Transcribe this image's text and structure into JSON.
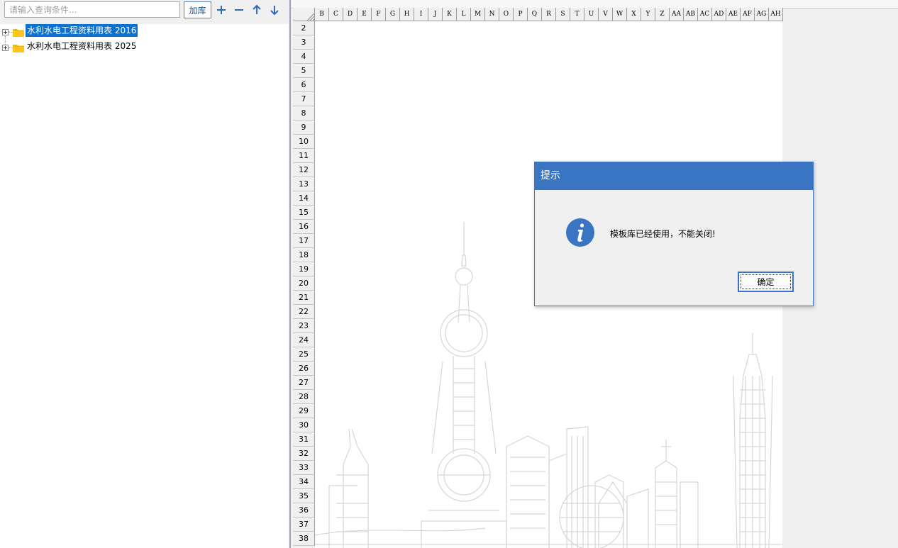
{
  "search": {
    "placeholder": "请输入查询条件..."
  },
  "toolbar": {
    "add_library_label": "加库",
    "icons": [
      "plus-icon",
      "minus-icon",
      "arrow-up-icon",
      "arrow-down-icon"
    ]
  },
  "tree": {
    "items": [
      {
        "label": "水利水电工程资料用表 2016",
        "selected": true
      },
      {
        "label": "水利水电工程资料用表 2025",
        "selected": false
      }
    ]
  },
  "sheet": {
    "columns": [
      "B",
      "C",
      "D",
      "E",
      "F",
      "G",
      "H",
      "I",
      "J",
      "K",
      "L",
      "M",
      "N",
      "O",
      "P",
      "Q",
      "R",
      "S",
      "T",
      "U",
      "V",
      "W",
      "X",
      "Y",
      "Z",
      "AA",
      "AB",
      "AC",
      "AD",
      "AE",
      "AF",
      "AG",
      "AH"
    ],
    "rows": [
      "2",
      "3",
      "4",
      "5",
      "6",
      "7",
      "8",
      "9",
      "10",
      "11",
      "12",
      "13",
      "14",
      "15",
      "16",
      "17",
      "18",
      "19",
      "20",
      "21",
      "22",
      "23",
      "24",
      "25",
      "26",
      "27",
      "28",
      "29",
      "30",
      "31",
      "32",
      "33",
      "34",
      "35",
      "36",
      "37",
      "38"
    ]
  },
  "dialog": {
    "title": "提示",
    "message": "模板库已经使用，不能关闭!",
    "ok_label": "确定",
    "icon": "info-icon"
  },
  "colors": {
    "accent": "#3a75c4",
    "selection": "#0a72d1",
    "folder": "#f5b800",
    "toolbar_icon": "#2f6bbd"
  }
}
